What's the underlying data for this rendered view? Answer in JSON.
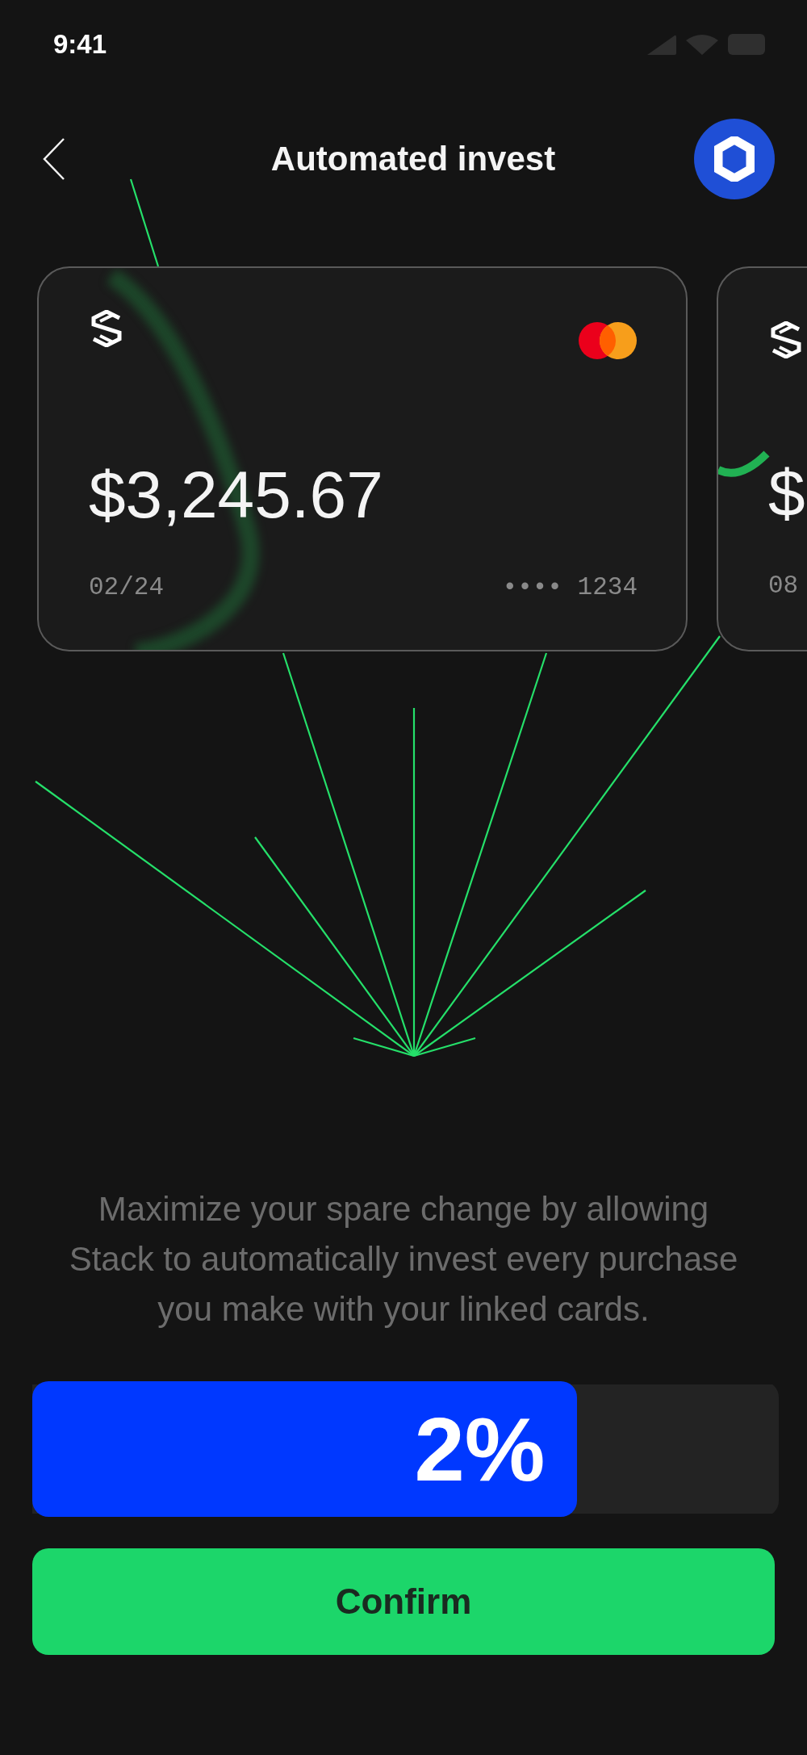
{
  "status_bar": {
    "time": "9:41"
  },
  "header": {
    "title": "Automated invest"
  },
  "cards": [
    {
      "amount": "$3,245.67",
      "expiry": "02/24",
      "number": "•••• 1234"
    },
    {
      "amount": "$",
      "expiry": "08"
    }
  ],
  "description": "Maximize your spare change by allowing Stack to automatically invest every purchase you make with your linked cards.",
  "slider": {
    "level": 0.73,
    "reading": "2%"
  },
  "confirm_button": {
    "label": "Confirm"
  }
}
